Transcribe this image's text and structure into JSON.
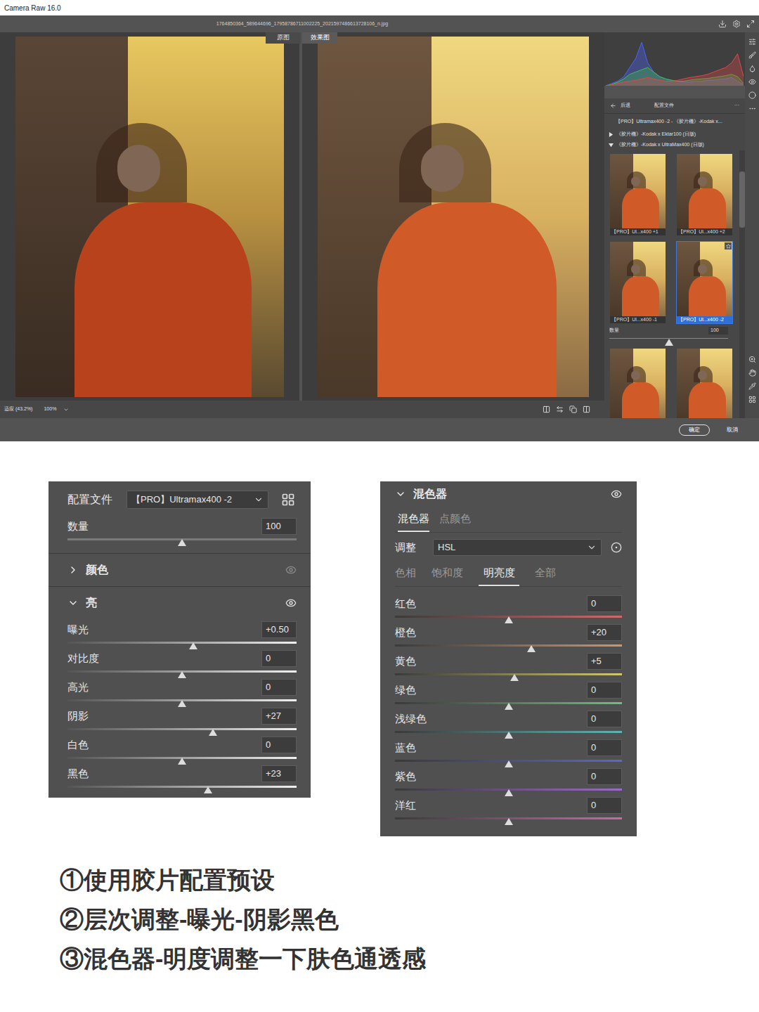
{
  "window": {
    "title": "Camera Raw 16.0",
    "filename": "1764850364_589644696_17958786711002225_2021597486613728106_n.jpg"
  },
  "view_tabs": [
    {
      "label": "原图",
      "selected": false
    },
    {
      "label": "效果图",
      "selected": true
    }
  ],
  "zoom": {
    "fit": "适应 (43.2%)",
    "level": "100%"
  },
  "histogram": {
    "series": [
      {
        "color": "#4a63ff",
        "values": [
          0,
          0.05,
          0.1,
          0.2,
          0.4,
          0.6,
          0.95,
          0.5,
          0.3,
          0.2,
          0.15,
          0.12,
          0.1,
          0.08,
          0.08,
          0.1,
          0.1,
          0.12,
          0.12,
          0.14,
          0.15,
          0.18,
          0.1,
          0.02
        ]
      },
      {
        "color": "#3fbf4a",
        "values": [
          0,
          0.03,
          0.08,
          0.15,
          0.25,
          0.3,
          0.35,
          0.4,
          0.3,
          0.2,
          0.15,
          0.12,
          0.1,
          0.1,
          0.12,
          0.14,
          0.15,
          0.16,
          0.18,
          0.2,
          0.22,
          0.25,
          0.2,
          0.05
        ]
      },
      {
        "color": "#e04848",
        "values": [
          0,
          0.02,
          0.05,
          0.08,
          0.1,
          0.12,
          0.15,
          0.18,
          0.15,
          0.12,
          0.1,
          0.1,
          0.12,
          0.15,
          0.18,
          0.2,
          0.22,
          0.25,
          0.3,
          0.35,
          0.4,
          0.5,
          0.7,
          0.2
        ]
      }
    ]
  },
  "profile_browser": {
    "back": "后退",
    "title": "配置文件",
    "more": "···",
    "current": "【PRO】Ultramax400 -2 - 《胶片機》-Kodak x...",
    "groups": [
      {
        "label": "《胶片機》-Kodak x Ektar100 (日版)",
        "expanded": false
      },
      {
        "label": "《胶片機》-Kodak x UltraMax400 (日版)",
        "expanded": true
      }
    ],
    "thumbnails": [
      {
        "caption": "【PRO】Ul...x400 +1",
        "selected": false,
        "favorite": false
      },
      {
        "caption": "【PRO】Ul...x400 +2",
        "selected": false,
        "favorite": false
      },
      {
        "caption": "【PRO】Ul...x400 -1",
        "selected": false,
        "favorite": false
      },
      {
        "caption": "【PRO】Ul...x400 -2",
        "selected": true,
        "favorite": true
      }
    ],
    "amount": {
      "label": "数量",
      "value": "100",
      "level": 0.5
    },
    "more_thumbnails": [
      {
        "selected": false
      },
      {
        "selected": false
      }
    ]
  },
  "buttons": [
    {
      "label": "确定",
      "primary": true
    },
    {
      "label": "取消",
      "primary": false
    }
  ],
  "profile_panel": {
    "label": "配置文件",
    "value": "【PRO】Ultramax400 -2",
    "amount": {
      "label": "数量",
      "value": "100",
      "level": 0.5
    },
    "sections": [
      {
        "label": "颜色",
        "expanded": false
      },
      {
        "label": "亮",
        "expanded": true
      }
    ],
    "sliders": [
      {
        "label": "曝光",
        "value": "+0.50",
        "level": 0.55
      },
      {
        "label": "对比度",
        "value": "0",
        "level": 0.5
      },
      {
        "label": "高光",
        "value": "0",
        "level": 0.5
      },
      {
        "label": "阴影",
        "value": "+27",
        "level": 0.635
      },
      {
        "label": "白色",
        "value": "0",
        "level": 0.5
      },
      {
        "label": "黑色",
        "value": "+23",
        "level": 0.615
      }
    ]
  },
  "mixer": {
    "title": "混色器",
    "expanded": true,
    "tabs": [
      {
        "label": "混色器",
        "selected": true
      },
      {
        "label": "点颜色",
        "selected": false
      }
    ],
    "adjust": {
      "label": "调整",
      "value": "HSL"
    },
    "subtabs": [
      {
        "label": "色相",
        "selected": false
      },
      {
        "label": "饱和度",
        "selected": false
      },
      {
        "label": "明亮度",
        "selected": true
      },
      {
        "label": "全部",
        "selected": false
      }
    ],
    "rows": [
      {
        "name": "红色",
        "value": "0",
        "level": 0.5,
        "color": "#d06a6a"
      },
      {
        "name": "橙色",
        "value": "+20",
        "level": 0.6,
        "color": "#d0966a"
      },
      {
        "name": "黄色",
        "value": "+5",
        "level": 0.525,
        "color": "#cfc872"
      },
      {
        "name": "绿色",
        "value": "0",
        "level": 0.5,
        "color": "#6cbf7a"
      },
      {
        "name": "浅绿色",
        "value": "0",
        "level": 0.5,
        "color": "#5cb4b0"
      },
      {
        "name": "蓝色",
        "value": "0",
        "level": 0.5,
        "color": "#5a68c8"
      },
      {
        "name": "紫色",
        "value": "0",
        "level": 0.5,
        "color": "#9a6ac8"
      },
      {
        "name": "洋红",
        "value": "0",
        "level": 0.5,
        "color": "#c86aa8"
      }
    ]
  },
  "steps": [
    "①使用胶片配置预设",
    "②层次调整-曝光-阴影黑色",
    "③混色器-明度调整一下肤色通透感"
  ]
}
